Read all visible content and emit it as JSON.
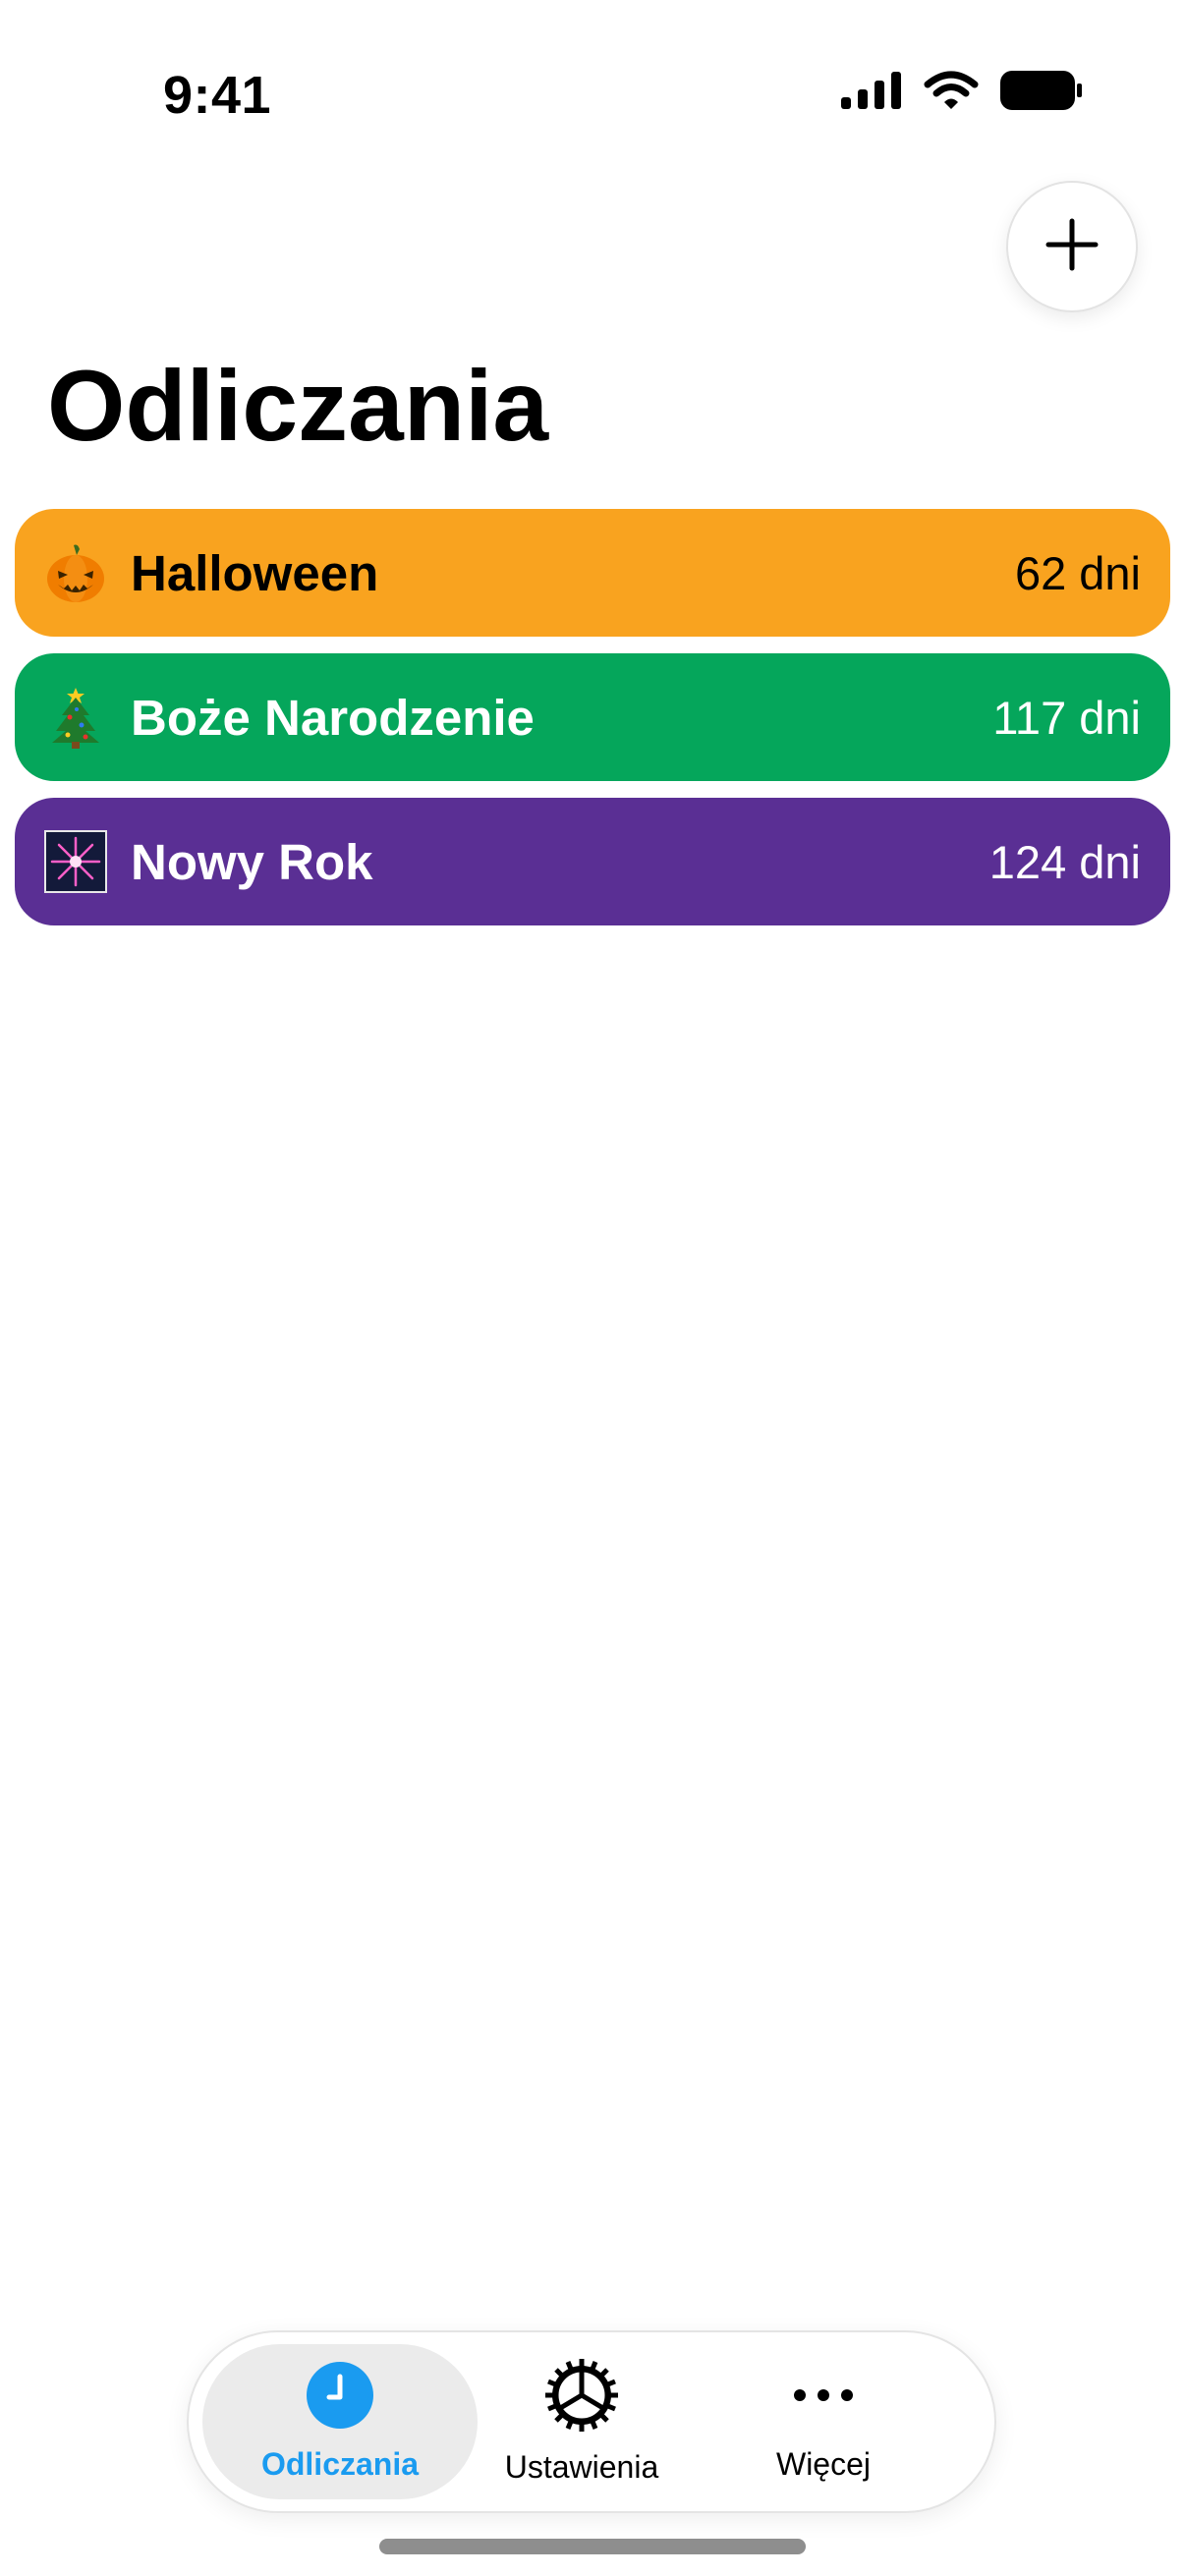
{
  "status_bar": {
    "time": "9:41",
    "icons": [
      "cellular-signal-icon",
      "wifi-icon",
      "battery-icon"
    ]
  },
  "header": {
    "add_icon": "plus-icon",
    "title": "Odliczania"
  },
  "countdowns": [
    {
      "emoji": "🎃",
      "name": "Halloween",
      "days": "62 dni",
      "color": "#F9A31F",
      "text_color": "#000000"
    },
    {
      "emoji": "🎄",
      "name": "Boże Narodzenie",
      "days": "117 dni",
      "color": "#05A65B",
      "text_color": "#FFFFFF"
    },
    {
      "emoji": "🎇",
      "name": "Nowy Rok",
      "days": "124 dni",
      "color": "#5A2F94",
      "text_color": "#FFFFFF"
    }
  ],
  "tab_bar": {
    "tabs": [
      {
        "label": "Odliczania",
        "icon": "clock-icon",
        "active": true
      },
      {
        "label": "Ustawienia",
        "icon": "gear-icon",
        "active": false
      },
      {
        "label": "Więcej",
        "icon": "more-icon",
        "active": false
      }
    ],
    "active_color": "#1A9BF0"
  }
}
